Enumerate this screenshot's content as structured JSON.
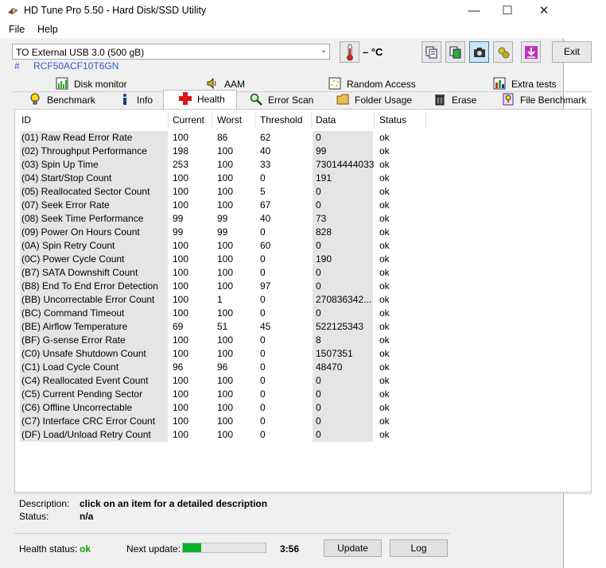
{
  "window": {
    "title": "HD Tune Pro 5.50 - Hard Disk/SSD Utility"
  },
  "menu": {
    "file": "File",
    "help": "Help"
  },
  "toolbar": {
    "drive": "TO External USB 3.0 (500 gB)",
    "serial_hash": "#",
    "serial": "RCF50ACF10T6GN",
    "temperature": "– °C",
    "exit": "Exit"
  },
  "tabs_top": [
    {
      "label": "Disk monitor",
      "icon": "disk-monitor-icon"
    },
    {
      "label": "AAM",
      "icon": "speaker-icon"
    },
    {
      "label": "Random Access",
      "icon": "random-access-icon"
    },
    {
      "label": "Extra tests",
      "icon": "extra-tests-icon"
    }
  ],
  "tabs_bottom": [
    {
      "label": "Benchmark",
      "icon": "bulb-icon"
    },
    {
      "label": "Info",
      "icon": "info-icon"
    },
    {
      "label": "Health",
      "icon": "health-cross-icon",
      "selected": true
    },
    {
      "label": "Error Scan",
      "icon": "magnifier-icon"
    },
    {
      "label": "Folder Usage",
      "icon": "folder-icon"
    },
    {
      "label": "Erase",
      "icon": "trash-icon"
    },
    {
      "label": "File Benchmark",
      "icon": "file-benchmark-icon"
    }
  ],
  "columns": [
    "ID",
    "Current",
    "Worst",
    "Threshold",
    "Data",
    "Status"
  ],
  "rows": [
    [
      "(01) Raw Read Error Rate",
      "100",
      "86",
      "62",
      "0",
      "ok"
    ],
    [
      "(02) Throughput Performance",
      "198",
      "100",
      "40",
      "99",
      "ok"
    ],
    [
      "(03) Spin Up Time",
      "253",
      "100",
      "33",
      "73014444033",
      "ok"
    ],
    [
      "(04) Start/Stop Count",
      "100",
      "100",
      "0",
      "191",
      "ok"
    ],
    [
      "(05) Reallocated Sector Count",
      "100",
      "100",
      "5",
      "0",
      "ok"
    ],
    [
      "(07) Seek Error Rate",
      "100",
      "100",
      "67",
      "0",
      "ok"
    ],
    [
      "(08) Seek Time Performance",
      "99",
      "99",
      "40",
      "73",
      "ok"
    ],
    [
      "(09) Power On Hours Count",
      "99",
      "99",
      "0",
      "828",
      "ok"
    ],
    [
      "(0A) Spin Retry Count",
      "100",
      "100",
      "60",
      "0",
      "ok"
    ],
    [
      "(0C) Power Cycle Count",
      "100",
      "100",
      "0",
      "190",
      "ok"
    ],
    [
      "(B7) SATA Downshift Count",
      "100",
      "100",
      "0",
      "0",
      "ok"
    ],
    [
      "(B8) End To End Error Detection",
      "100",
      "100",
      "97",
      "0",
      "ok"
    ],
    [
      "(BB) Uncorrectable Error Count",
      "100",
      "1",
      "0",
      "270836342...",
      "ok"
    ],
    [
      "(BC) Command Timeout",
      "100",
      "100",
      "0",
      "0",
      "ok"
    ],
    [
      "(BE) Airflow Temperature",
      "69",
      "51",
      "45",
      "522125343",
      "ok"
    ],
    [
      "(BF) G-sense Error Rate",
      "100",
      "100",
      "0",
      "8",
      "ok"
    ],
    [
      "(C0) Unsafe Shutdown Count",
      "100",
      "100",
      "0",
      "1507351",
      "ok"
    ],
    [
      "(C1) Load Cycle Count",
      "96",
      "96",
      "0",
      "48470",
      "ok"
    ],
    [
      "(C4) Reallocated Event Count",
      "100",
      "100",
      "0",
      "0",
      "ok"
    ],
    [
      "(C5) Current Pending Sector",
      "100",
      "100",
      "0",
      "0",
      "ok"
    ],
    [
      "(C6) Offline Uncorrectable",
      "100",
      "100",
      "0",
      "0",
      "ok"
    ],
    [
      "(C7) Interface CRC Error Count",
      "100",
      "100",
      "0",
      "0",
      "ok"
    ],
    [
      "(DF) Load/Unload Retry Count",
      "100",
      "100",
      "0",
      "0",
      "ok"
    ]
  ],
  "description": {
    "label": "Description:",
    "value": "click on an item for a detailed description",
    "status_label": "Status:",
    "status_value": "n/a"
  },
  "footer": {
    "health_label": "Health status:",
    "health_value": "ok",
    "health_color": "#12a012",
    "next_update_label": "Next update:",
    "next_update_progress": 0.22,
    "next_update_time": "3:56",
    "update_button": "Update",
    "log_button": "Log"
  }
}
